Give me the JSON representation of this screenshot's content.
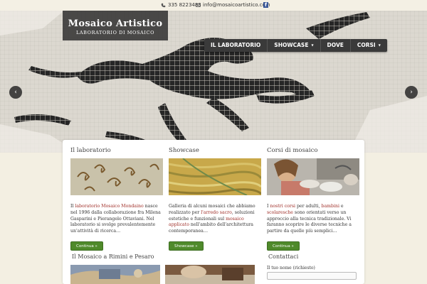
{
  "topbar": {
    "phone": "335 8223483",
    "email": "info@mosaicoartistico.com",
    "facebook_glyph": "f"
  },
  "brand": {
    "title": "Mosaico Artistico",
    "subtitle": "LABORATORIO DI MOSAICO"
  },
  "nav": {
    "items": [
      {
        "label": "IL LABORATORIO"
      },
      {
        "label": "SHOWCASE",
        "dropdown": true
      },
      {
        "label": "DOVE"
      },
      {
        "label": "CORSI",
        "dropdown": true
      }
    ],
    "caret": "▼"
  },
  "slider": {
    "prev": "‹",
    "next": "›"
  },
  "columns": [
    {
      "title": "Il laboratorio",
      "text_parts": [
        "Il ",
        "laboratorio Mosaico Mondaino",
        " nasce nel 1996 dalla collaborazione fra Milena Gasparini e Pierangelo Ottaviani. Nel laboratorio si svolge prevalentemente un'attività di ricerca…"
      ],
      "button": "Continua »"
    },
    {
      "title": "Showcase",
      "text_parts": [
        "Galleria di alcuni mosaici che abbiamo realizzato per ",
        "l'arredo sacro",
        ", soluzioni estetiche e funzionali sul ",
        "mosaico applicato",
        " nell'ambito dell'architettura contemporanea…"
      ],
      "button": "Showcase »"
    },
    {
      "title": "Corsi di mosaico",
      "text_parts": [
        "I ",
        "nostri corsi",
        " per adulti, ",
        "bambini",
        " e ",
        "scolaresche",
        " sono orientati verso un approccio alla tecnica tradizionale. Vi faranno scoprire le diverse tecniche a partire da quelle più semplici…"
      ],
      "button": "Continua »"
    }
  ],
  "section2": {
    "left_title": "Il Mosaico a Rimini e Pesaro",
    "right_title": "Contattaci",
    "form_label": "Il tuo nome (richiesto)"
  },
  "colors": {
    "accent_link": "#a0302a",
    "button_green": "#4f8a2b",
    "nav_bg": "#3a3a3a",
    "page_bg": "#f3efe2"
  }
}
